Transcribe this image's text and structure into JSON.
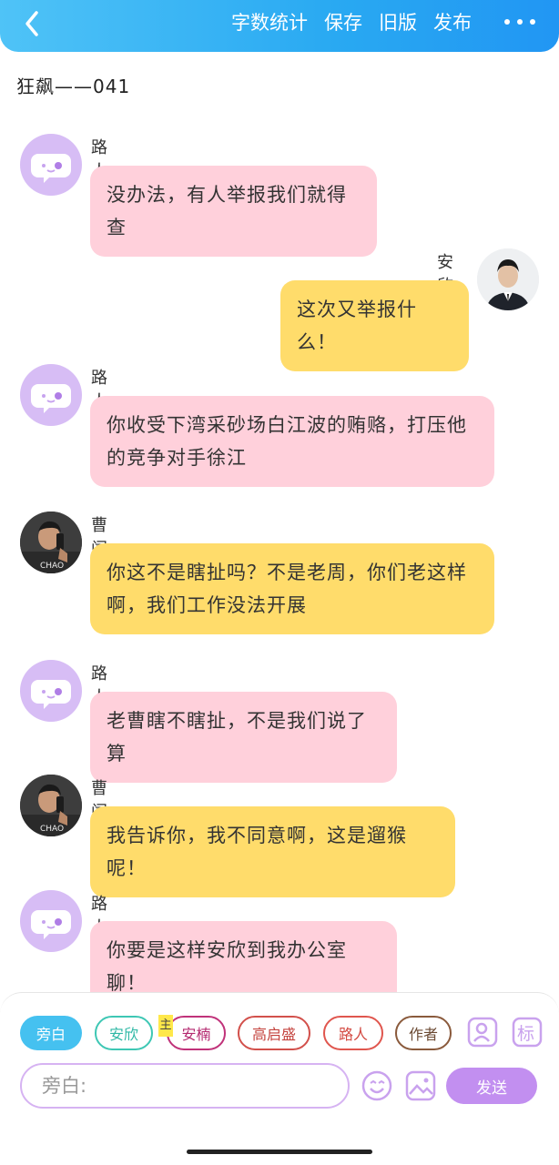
{
  "header": {
    "actions": [
      "字数统计",
      "保存",
      "旧版",
      "发布"
    ]
  },
  "chapter_title": "狂飙——041",
  "messages": [
    {
      "speaker": "路人",
      "text": "没办法，有人举报我们就得查",
      "side": "left",
      "avatar": "narrator-chat-icon"
    },
    {
      "speaker": "安欣",
      "text": "这次又举报什么！",
      "side": "right",
      "avatar": "man-in-suit-photo"
    },
    {
      "speaker": "路人",
      "text": "你收受下湾采砂场白江波的贿赂，打压他的竞争对手徐江",
      "side": "left",
      "avatar": "narrator-chat-icon"
    },
    {
      "speaker": "曹闯",
      "text": "你这不是瞎扯吗？不是老周，你们老这样啊，我们工作没法开展",
      "side": "left",
      "avatar": "man-on-phone-photo"
    },
    {
      "speaker": "路人",
      "text": "老曹瞎不瞎扯，不是我们说了算",
      "side": "left",
      "avatar": "narrator-chat-icon"
    },
    {
      "speaker": "曹闯",
      "text": "我告诉你，我不同意啊，这是遛猴呢！",
      "side": "left",
      "avatar": "man-on-phone-photo"
    },
    {
      "speaker": "路人",
      "text": "你要是这样安欣到我办公室聊！",
      "side": "left",
      "avatar": "narrator-chat-icon"
    }
  ],
  "roles": [
    {
      "label": "旁白",
      "selected": true
    },
    {
      "label": "安欣",
      "selected": false
    },
    {
      "label": "安楠",
      "selected": false,
      "badge": "主"
    },
    {
      "label": "高启盛",
      "selected": false
    },
    {
      "label": "路人",
      "selected": false
    },
    {
      "label": "作者",
      "selected": false
    }
  ],
  "input": {
    "placeholder": "旁白:"
  },
  "send_label": "发送",
  "colors": {
    "header": "#29a9f2",
    "pink_bubble": "#ffd0db",
    "yellow_bubble": "#ffdc6b",
    "narrator_avatar": "#d7bdf5",
    "send_button": "#c28ff0"
  }
}
